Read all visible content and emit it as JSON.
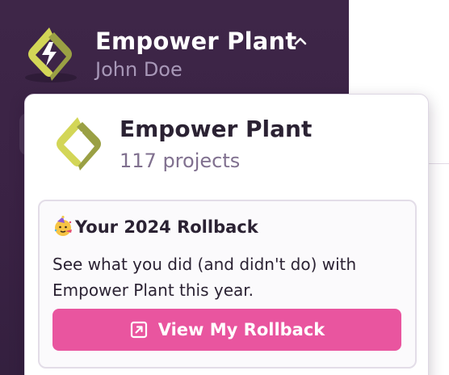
{
  "header": {
    "org_name": "Empower Plant",
    "user_name": "John Doe",
    "chevron_icon": "chevron-up-icon"
  },
  "dropdown": {
    "org_name": "Empower Plant",
    "project_count": "117 projects",
    "rollback": {
      "emoji_icon": "party-face-icon",
      "heading": "Your 2024 Rollback",
      "body": "See what you did (and didn't do) with Empower Plant this year.",
      "button_label": "View My Rollback",
      "button_icon": "open-external-icon"
    }
  },
  "colors": {
    "sidebar": "#3e2648",
    "accent_pink": "#e9559f",
    "logo_light": "#d6d85a",
    "logo_dark": "#9aa044",
    "muted_text": "#80708f"
  }
}
